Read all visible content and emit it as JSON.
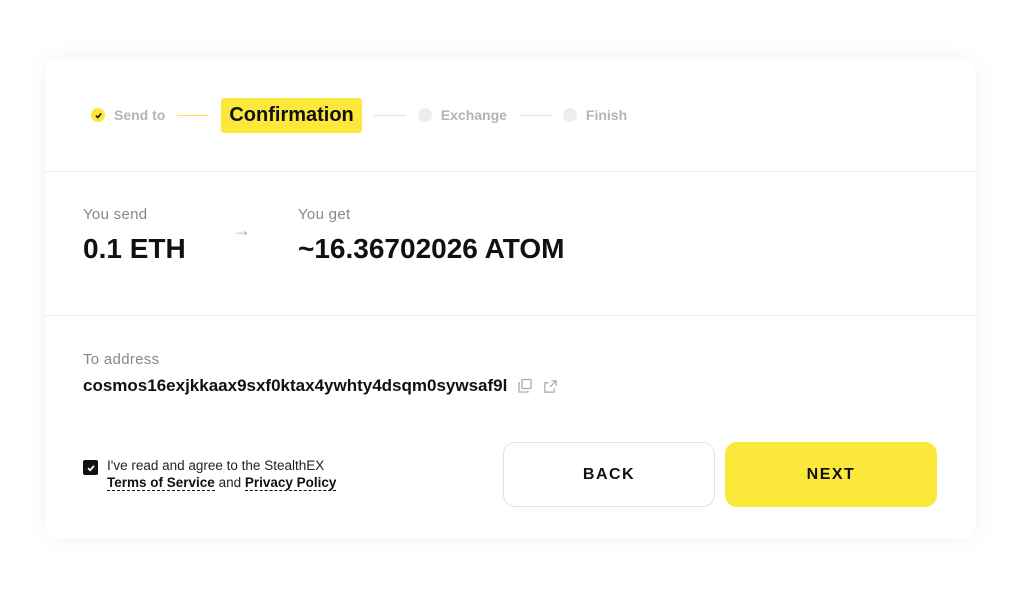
{
  "steps": [
    {
      "label": "Send to",
      "state": "done"
    },
    {
      "label": "Confirmation",
      "state": "active"
    },
    {
      "label": "Exchange",
      "state": "pending"
    },
    {
      "label": "Finish",
      "state": "pending"
    }
  ],
  "exchange": {
    "send_label": "You send",
    "send_value": "0.1 ETH",
    "get_label": "You get",
    "get_value": "~16.36702026 ATOM",
    "arrow": "→"
  },
  "address": {
    "label": "To address",
    "value": "cosmos16exjkkaax9sxf0ktax4ywhty4dsqm0sywsaf9l"
  },
  "agreement": {
    "checked": true,
    "text": "I've read and agree to the StealthEX",
    "terms_link": "Terms of Service",
    "and": "and",
    "privacy_link": "Privacy Policy"
  },
  "buttons": {
    "back": "BACK",
    "next": "NEXT"
  },
  "colors": {
    "accent": "#fce83a"
  }
}
